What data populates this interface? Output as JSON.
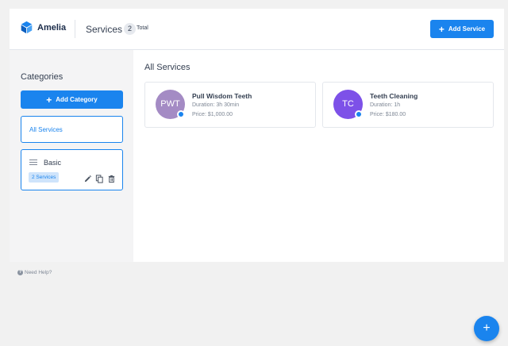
{
  "colors": {
    "accent": "#1a84ee",
    "avatar_pwt": "#a48bc4",
    "avatar_tc": "#7d51e8",
    "background": "#f1f1f1"
  },
  "header": {
    "logo_text": "Amelia",
    "title": "Services",
    "count": "2",
    "count_label": "Total",
    "add_service_label": "Add Service"
  },
  "sidebar": {
    "title": "Categories",
    "add_category_label": "Add Category",
    "all_services_label": "All Services",
    "categories": [
      {
        "name": "Basic",
        "badge": "2 Services"
      }
    ]
  },
  "main": {
    "title": "All Services",
    "services": [
      {
        "initials": "PWT",
        "name": "Pull Wisdom Teeth",
        "duration": "Duration: 3h 30min",
        "price": "Price: $1,000.00"
      },
      {
        "initials": "TC",
        "name": "Teeth Cleaning",
        "duration": "Duration: 1h",
        "price": "Price: $180.00"
      }
    ]
  },
  "footer": {
    "help_label": "Need Help?"
  },
  "icons": [
    "plus-icon",
    "drag-handle-icon",
    "edit-icon",
    "duplicate-icon",
    "delete-icon",
    "question-icon"
  ]
}
